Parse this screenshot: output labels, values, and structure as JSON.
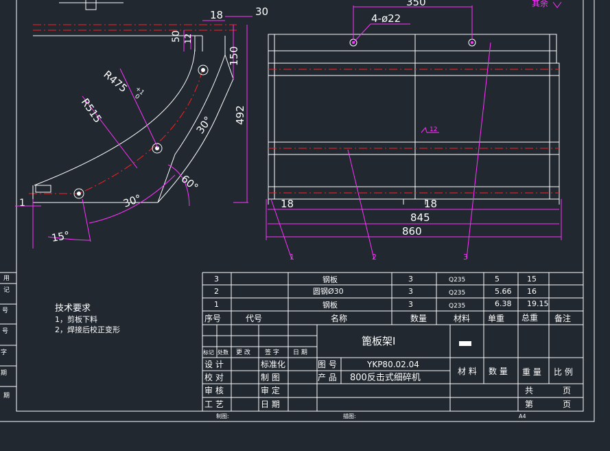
{
  "colors": {
    "background": "#212830",
    "line": "#ffffff",
    "dimension": "#ff33ff",
    "centerline": "#ff2020"
  },
  "top_right_note": "其余",
  "left_view": {
    "dims": {
      "d1": "18",
      "d2": "30",
      "d3": "50",
      "d4": "12",
      "d5": "150",
      "d6": "492",
      "d7": "1",
      "r1": "R475",
      "r1_tol": "+1",
      "r1_tol2": "0",
      "r2": "R515",
      "a1": "30°",
      "a2": "60°",
      "a3": "30°",
      "a4": "15°"
    }
  },
  "right_view": {
    "dims": {
      "top": "350",
      "holes": "4-ø22",
      "left18": "18",
      "right18": "18",
      "w845": "845",
      "w860": "860",
      "rough": "12"
    },
    "balloons": [
      "1",
      "2",
      "3"
    ]
  },
  "tech_requirements": {
    "title": "技术要求",
    "items": [
      "1，剪板下料",
      "2，焊接后校正变形"
    ]
  },
  "left_strip": [
    "用",
    "记",
    "号",
    "号",
    "字",
    "期",
    "期"
  ],
  "bom": {
    "rows": [
      {
        "no": "3",
        "code": "",
        "name": "钢板",
        "qty": "3",
        "material": "Q235",
        "unit": "5",
        "total": "15",
        "note": ""
      },
      {
        "no": "2",
        "code": "",
        "name": "圆钢Ø30",
        "qty": "3",
        "material": "Q235",
        "unit": "5.66",
        "total": "16",
        "note": ""
      },
      {
        "no": "1",
        "code": "",
        "name": "钢板",
        "qty": "3",
        "material": "Q235",
        "unit": "6.38",
        "total": "19.15",
        "note": ""
      }
    ],
    "headers": {
      "no": "序号",
      "code": "代号",
      "name": "名称",
      "qty": "数量",
      "material": "材料",
      "unit": "单重",
      "total": "总重",
      "note": "备注"
    }
  },
  "title_block": {
    "part_name": "篦板架I",
    "logo_text": "",
    "rev_headers": {
      "mark": "标记",
      "zone": "处数",
      "change": "更 改",
      "sign": "签 字",
      "date": "日 期"
    },
    "row_labels": {
      "design": "设 计",
      "check": "校 对",
      "review": "审 核",
      "process": "工 艺",
      "standard": "标准化",
      "draw": "制 图",
      "approve": "审 定",
      "date": "日 期"
    },
    "drawing_no_label": "图 号",
    "drawing_no": "YKP80.02.04",
    "product_label": "产 品",
    "product": "800反击式细碎机",
    "col_material": "材 料",
    "col_qty": "数 量",
    "col_weight": "重 量",
    "col_scale": "比 例",
    "total_label": "共",
    "sheet_label": "第",
    "page_label1": "页",
    "page_label2": "页"
  },
  "footer": {
    "drawn_label": "制图:",
    "plot_label": "描图:",
    "size": "A4"
  }
}
